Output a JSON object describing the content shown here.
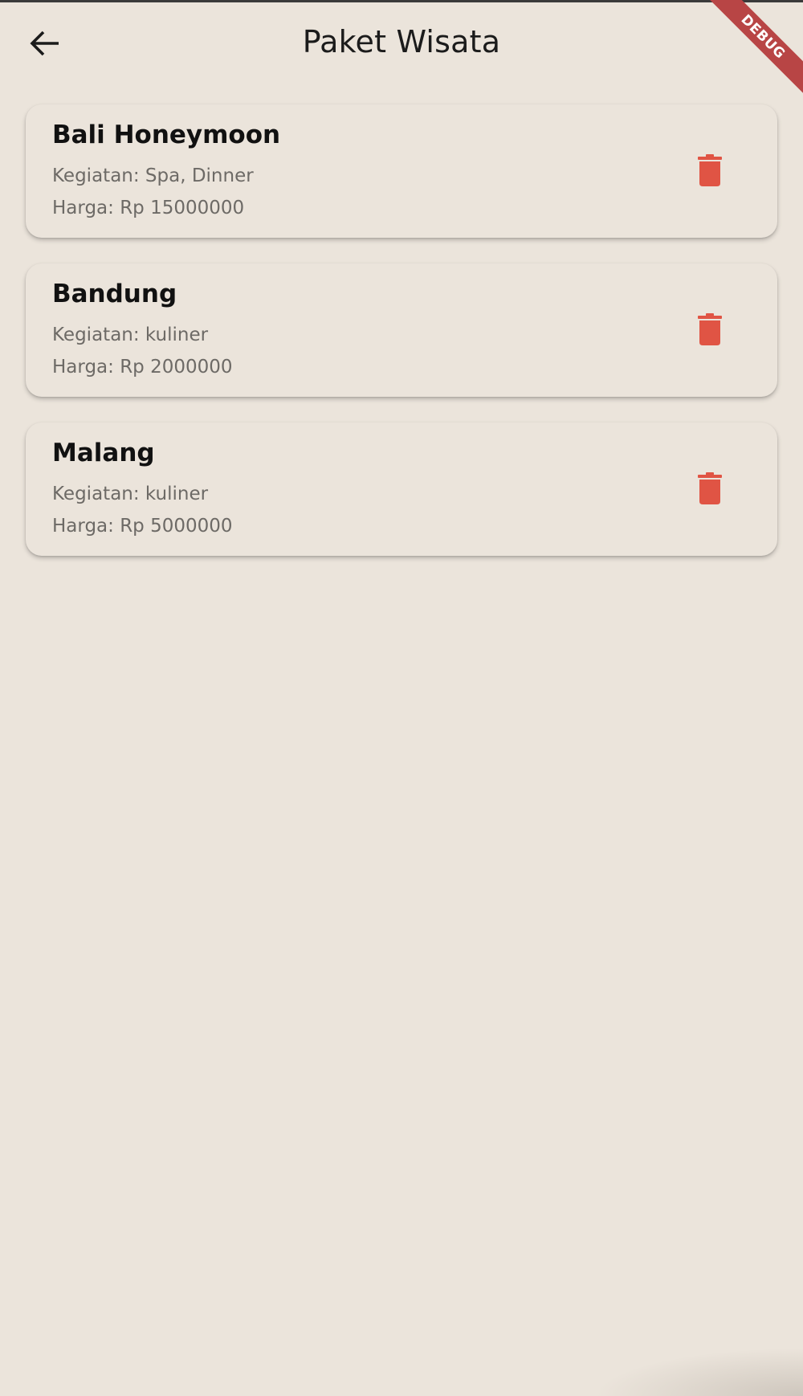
{
  "app_bar": {
    "title": "Paket Wisata",
    "back_icon": "arrow-back-icon"
  },
  "debug_banner": {
    "label": "DEBUG"
  },
  "packages": [
    {
      "name": "Bali Honeymoon",
      "activity": "Kegiatan: Spa, Dinner",
      "price": "Harga: Rp 15000000"
    },
    {
      "name": "Bandung",
      "activity": "Kegiatan: kuliner",
      "price": "Harga: Rp 2000000"
    },
    {
      "name": "Malang",
      "activity": "Kegiatan: kuliner",
      "price": "Harga: Rp 5000000"
    }
  ],
  "colors": {
    "background": "#ebe4db",
    "delete_icon": "#e05444",
    "debug_ribbon": "#b84545"
  },
  "icons": {
    "delete": "trash-icon"
  }
}
